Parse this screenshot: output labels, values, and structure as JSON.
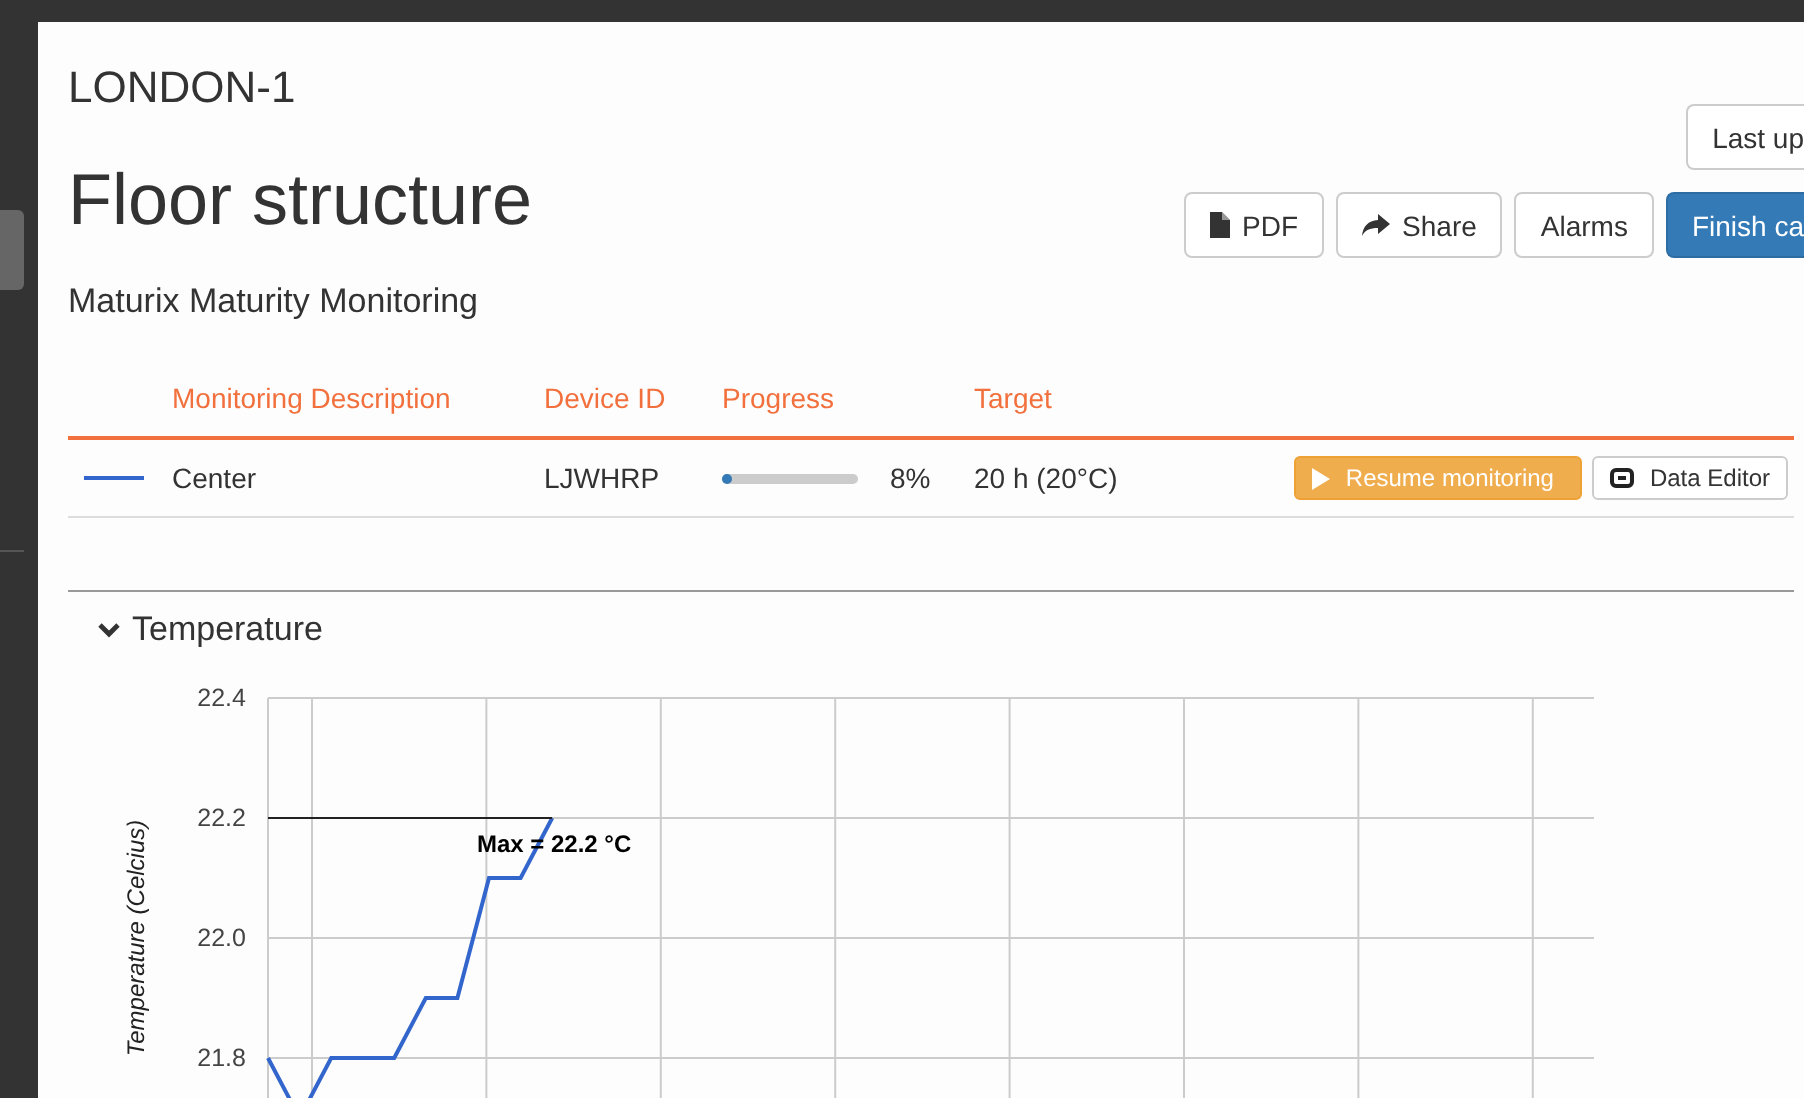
{
  "site": "LONDON-1",
  "title": "Floor structure",
  "subtitle": "Maturix Maturity Monitoring",
  "last_updated_button": "Last up",
  "toolbar": [
    {
      "kind": "pdf",
      "label": "PDF"
    },
    {
      "kind": "share",
      "label": "Share"
    },
    {
      "kind": "plain",
      "label": "Alarms"
    },
    {
      "kind": "primary",
      "label": "Finish ca"
    }
  ],
  "table": {
    "columns": [
      "Monitoring Description",
      "Device ID",
      "Progress",
      "Target"
    ],
    "rows": [
      {
        "color": "#3366cc",
        "description": "Center",
        "device_id": "LJWHRP",
        "progress": {
          "level": 0.08,
          "reading": "8%"
        },
        "target": "20 h (20°C)",
        "actions": [
          {
            "kind": "resume",
            "label": "Resume monitoring"
          },
          {
            "kind": "editor",
            "label": "Data Editor"
          }
        ]
      }
    ]
  },
  "temperature": {
    "title": "Temperature",
    "expanded": true,
    "chart_data": {
      "type": "line",
      "ylabel": "Temperature (Celcius)",
      "grid": true,
      "ylim": [
        21.7,
        22.4
      ],
      "yticks": [
        {
          "value": 22.4,
          "label": "22.4"
        },
        {
          "value": 22.2,
          "label": "22.2"
        },
        {
          "value": 22.0,
          "label": "22.0"
        },
        {
          "value": 21.8,
          "label": "21.8"
        }
      ],
      "categories": [
        null,
        null,
        null,
        null,
        null,
        null,
        null,
        null,
        null,
        null,
        null,
        null,
        null,
        null,
        null,
        null,
        null,
        null,
        null,
        null,
        null,
        null,
        null,
        null,
        null,
        null,
        null,
        null,
        null,
        null,
        null,
        null,
        null,
        null,
        null,
        null,
        null,
        null,
        null,
        null,
        null,
        null,
        null
      ],
      "series": [
        {
          "color": "#3366cc",
          "values": [
            21.8,
            21.7,
            21.8,
            21.8,
            21.8,
            21.9,
            21.9,
            22.1,
            22.1,
            22.2,
            null,
            null,
            null,
            null,
            null,
            null,
            null,
            null,
            null,
            null,
            null,
            null,
            null,
            null,
            null,
            null,
            null,
            null,
            null,
            null,
            null,
            null,
            null,
            null,
            null,
            null,
            null,
            null,
            null,
            null,
            null,
            null,
            null
          ]
        }
      ],
      "annotations": [
        "Max = 22.2 °C"
      ]
    }
  }
}
